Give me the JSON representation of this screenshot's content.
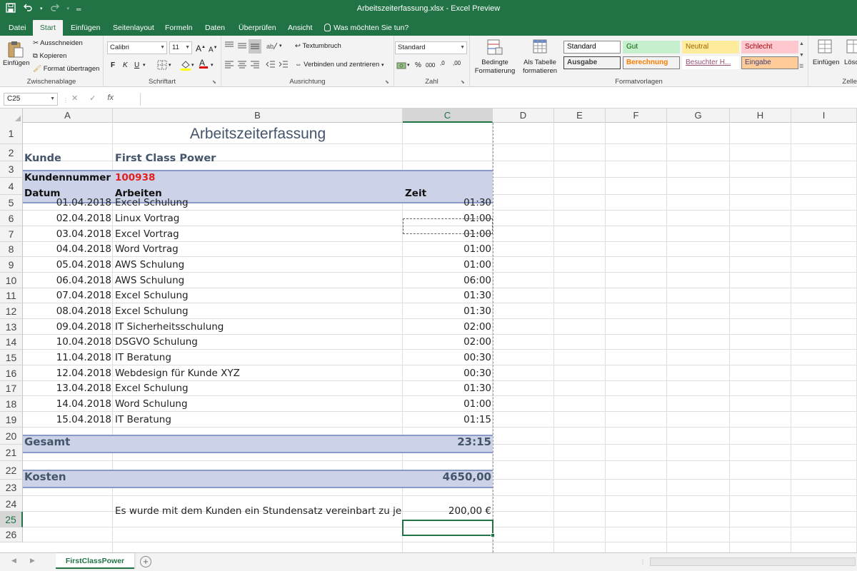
{
  "window": {
    "title": "Arbeitszeiterfassung.xlsx  -  Excel Preview",
    "qat_icons": [
      "save-icon",
      "undo-icon",
      "redo-icon",
      "customize-icon"
    ]
  },
  "tabs": [
    {
      "label": "Datei",
      "active": false
    },
    {
      "label": "Start",
      "active": true
    },
    {
      "label": "Einfügen",
      "active": false
    },
    {
      "label": "Seitenlayout",
      "active": false
    },
    {
      "label": "Formeln",
      "active": false
    },
    {
      "label": "Daten",
      "active": false
    },
    {
      "label": "Überprüfen",
      "active": false
    },
    {
      "label": "Ansicht",
      "active": false
    }
  ],
  "tell_me": "Was möchten Sie tun?",
  "ribbon": {
    "clipboard": {
      "paste": "Einfügen",
      "cut": "Ausschneiden",
      "copy": "Kopieren",
      "format_painter": "Format übertragen",
      "label": "Zwischenablage"
    },
    "font": {
      "name": "Calibri",
      "size": "11",
      "grow": "A",
      "shrink": "A",
      "bold": "F",
      "italic": "K",
      "underline": "U",
      "color_letter": "A",
      "label": "Schriftart",
      "fill_color": "#ffff00",
      "font_color": "#e00000"
    },
    "alignment": {
      "wrap": "Textumbruch",
      "merge": "Verbinden und zentrieren",
      "label": "Ausrichtung"
    },
    "number": {
      "format": "Standard",
      "label": "Zahl",
      "percent": "%",
      "thousands": "000",
      "inc": ",0",
      "dec": ",00"
    },
    "styles": {
      "conditional": "Bedingte",
      "conditional2": "Formatierung",
      "as_table": "Als Tabelle",
      "as_table2": "formatieren",
      "label": "Formatvorlagen",
      "boxes": [
        {
          "label": "Standard",
          "bg": "#ffffff",
          "color": "#000000",
          "border": "#8a8a8a"
        },
        {
          "label": "Gut",
          "bg": "#c6efce",
          "color": "#006100",
          "border": "#c6efce"
        },
        {
          "label": "Neutral",
          "bg": "#ffeb9c",
          "color": "#9c6500",
          "border": "#ffeb9c"
        },
        {
          "label": "Schlecht",
          "bg": "#ffc7ce",
          "color": "#9c0006",
          "border": "#ffc7ce"
        },
        {
          "label": "Ausgabe",
          "bg": "#f2f2f2",
          "color": "#3f3f3f",
          "border": "#3f3f3f"
        },
        {
          "label": "Berechnung",
          "bg": "#f2f2f2",
          "color": "#fa7d00",
          "border": "#7f7f7f"
        },
        {
          "label": "Besuchter H...",
          "bg": "#ffffff",
          "color": "#954f72",
          "border": "#ffffff"
        },
        {
          "label": "Eingabe",
          "bg": "#ffcc99",
          "color": "#3f3f76",
          "border": "#7f7f7f"
        }
      ]
    },
    "cells": {
      "insert": "Einfügen",
      "delete": "Lösc",
      "label": "Zelle"
    }
  },
  "formula_bar": {
    "name_box": "C25",
    "cancel": "✕",
    "enter": "✓",
    "fx": "fx",
    "value": ""
  },
  "columns": [
    {
      "label": "A",
      "selected": false
    },
    {
      "label": "B",
      "selected": false
    },
    {
      "label": "C",
      "selected": true
    },
    {
      "label": "D",
      "selected": false
    },
    {
      "label": "E",
      "selected": false
    },
    {
      "label": "F",
      "selected": false
    },
    {
      "label": "G",
      "selected": false
    },
    {
      "label": "H",
      "selected": false
    },
    {
      "label": "I",
      "selected": false
    }
  ],
  "sheet": {
    "title": "Arbeitszeiterfassung",
    "customer_label": "Kunde",
    "customer_value": "First Class Power",
    "customer_no_label": "Kundennummer",
    "customer_no_value": "100938",
    "header_date": "Datum",
    "header_work": "Arbeiten",
    "header_time": "Zeit",
    "entries": [
      {
        "date": "01.04.2018",
        "work": "Excel Schulung",
        "time": "01:30"
      },
      {
        "date": "02.04.2018",
        "work": "Linux Vortrag",
        "time": "01:00"
      },
      {
        "date": "03.04.2018",
        "work": "Excel Vortrag",
        "time": "01:00"
      },
      {
        "date": "04.04.2018",
        "work": "Word Vortrag",
        "time": "01:00"
      },
      {
        "date": "05.04.2018",
        "work": "AWS Schulung",
        "time": "01:00"
      },
      {
        "date": "06.04.2018",
        "work": "AWS Schulung",
        "time": "06:00"
      },
      {
        "date": "07.04.2018",
        "work": "Excel Schulung",
        "time": "01:30"
      },
      {
        "date": "08.04.2018",
        "work": "Excel Schulung",
        "time": "01:30"
      },
      {
        "date": "09.04.2018",
        "work": "IT Sicherheitsschulung",
        "time": "02:00"
      },
      {
        "date": "10.04.2018",
        "work": "DSGVO Schulung",
        "time": "02:00"
      },
      {
        "date": "11.04.2018",
        "work": "IT Beratung",
        "time": "00:30"
      },
      {
        "date": "12.04.2018",
        "work": "Webdesign für Kunde XYZ",
        "time": "00:30"
      },
      {
        "date": "13.04.2018",
        "work": "Excel Schulung",
        "time": "01:30"
      },
      {
        "date": "14.04.2018",
        "work": "Word Schulung",
        "time": "01:00"
      },
      {
        "date": "15.04.2018",
        "work": "IT Beratung",
        "time": "01:15"
      }
    ],
    "total_label": "Gesamt",
    "total_value": "23:15",
    "cost_label": "Kosten",
    "cost_value": "4650,00",
    "rate_text": "Es wurde mit dem Kunden ein Stundensatz vereinbart zu je",
    "rate_value": "200,00 €",
    "selected_cell": "C25",
    "copy_marquee_cell": "C6"
  },
  "sheet_tabs": {
    "active": "FirstClassPower",
    "add": "+"
  }
}
